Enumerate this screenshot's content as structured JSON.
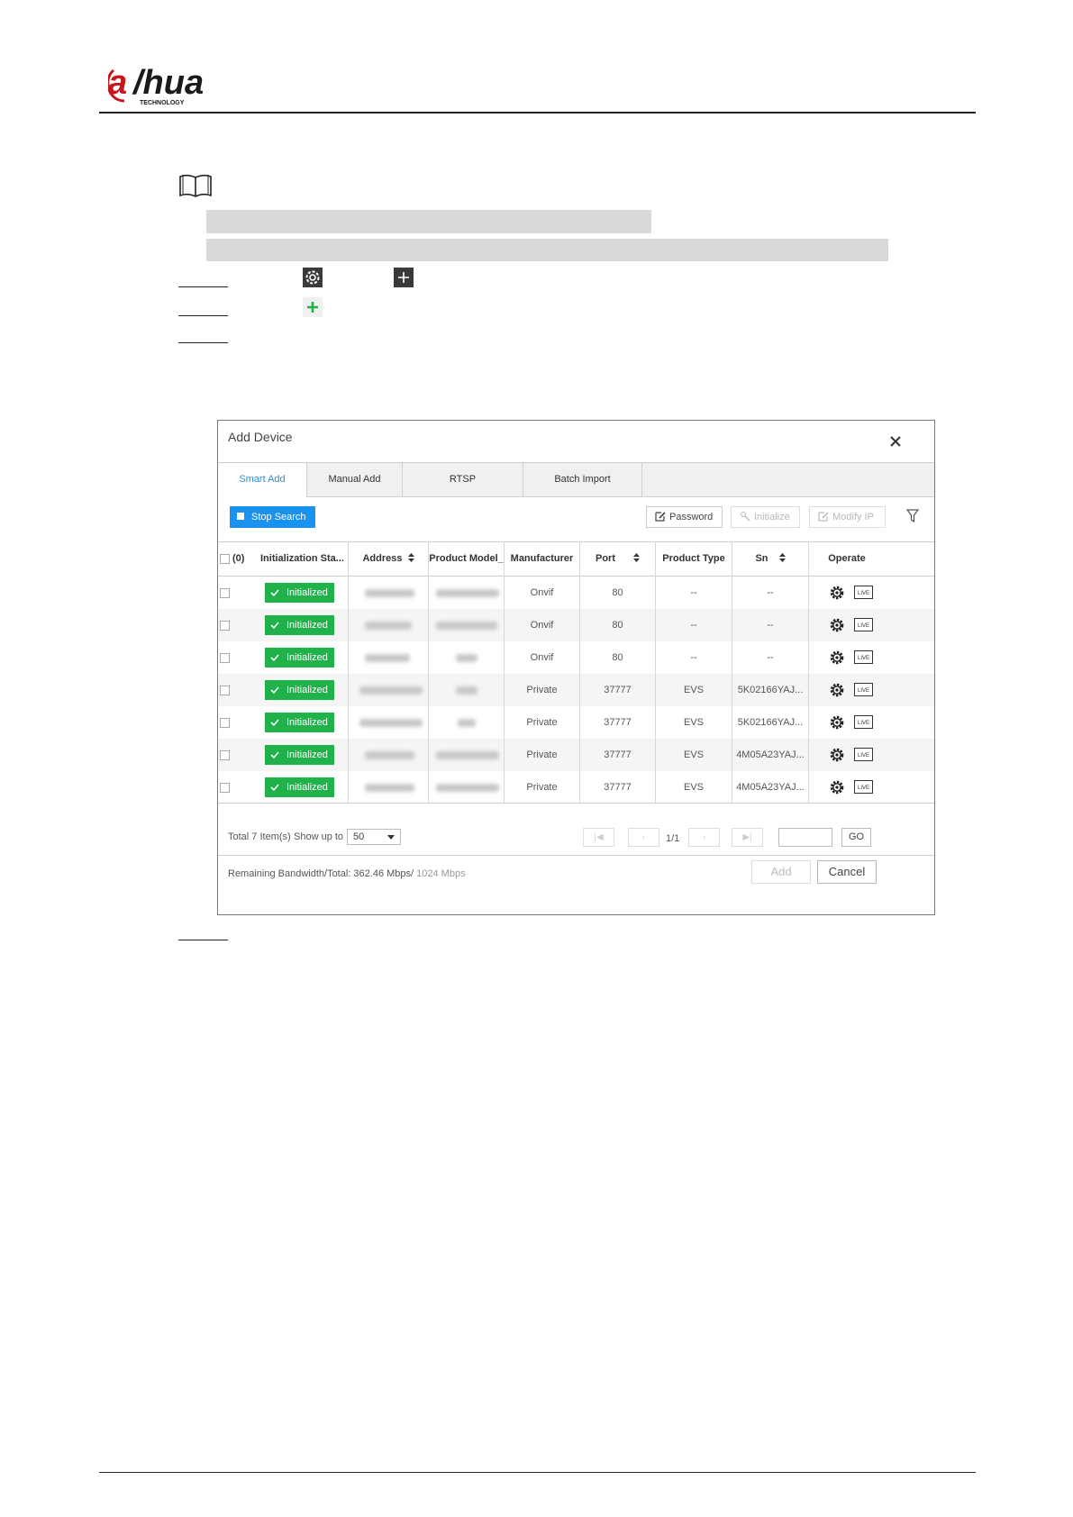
{
  "header": {
    "logo_text": "alhua",
    "logo_subtext": "TECHNOLOGY"
  },
  "dialog": {
    "title": "Add Device",
    "tabs": [
      {
        "label": "Smart Add",
        "active": true
      },
      {
        "label": "Manual Add",
        "active": false
      },
      {
        "label": "RTSP",
        "active": false
      },
      {
        "label": "Batch Import",
        "active": false
      }
    ],
    "toolbar": {
      "stop_search": "Stop Search",
      "password": "Password",
      "initialize": "Initialize",
      "modify_ip": "Modify IP"
    },
    "table": {
      "select_count": "(0)",
      "columns": [
        "Initialization Sta...",
        "Address",
        "Product Model_",
        "Manufacturer",
        "Port",
        "Product Type",
        "Sn",
        "Operate"
      ],
      "rows": [
        {
          "status": "Initialized",
          "manufacturer": "Onvif",
          "port": "80",
          "product_type": "--",
          "sn": "--"
        },
        {
          "status": "Initialized",
          "manufacturer": "Onvif",
          "port": "80",
          "product_type": "--",
          "sn": "--"
        },
        {
          "status": "Initialized",
          "manufacturer": "Onvif",
          "port": "80",
          "product_type": "--",
          "sn": "--"
        },
        {
          "status": "Initialized",
          "manufacturer": "Private",
          "port": "37777",
          "product_type": "EVS",
          "sn": "5K02166YAJ..."
        },
        {
          "status": "Initialized",
          "manufacturer": "Private",
          "port": "37777",
          "product_type": "EVS",
          "sn": "5K02166YAJ..."
        },
        {
          "status": "Initialized",
          "manufacturer": "Private",
          "port": "37777",
          "product_type": "EVS",
          "sn": "4M05A23YAJ..."
        },
        {
          "status": "Initialized",
          "manufacturer": "Private",
          "port": "37777",
          "product_type": "EVS",
          "sn": "4M05A23YAJ..."
        }
      ]
    },
    "footer": {
      "total": "Total 7 Item(s)",
      "show_up_to": "Show up to",
      "page_size": "50",
      "page_indicator": "1/1",
      "go": "GO",
      "bandwidth_label": "Remaining Bandwidth/Total: 362.46 Mbps/",
      "bandwidth_total": "1024 Mbps",
      "add": "Add",
      "cancel": "Cancel"
    }
  },
  "colors": {
    "accent_blue": "#1a93f0",
    "initialized_green": "#1fb24a",
    "tab_active_text": "#2b8fe0"
  },
  "icons": [
    "book-icon",
    "settings-gear-icon",
    "add-plus-icon",
    "green-plus-icon",
    "close-icon",
    "edit-icon",
    "filter-icon",
    "check-icon",
    "gear-icon",
    "live-icon",
    "sort-icon"
  ]
}
